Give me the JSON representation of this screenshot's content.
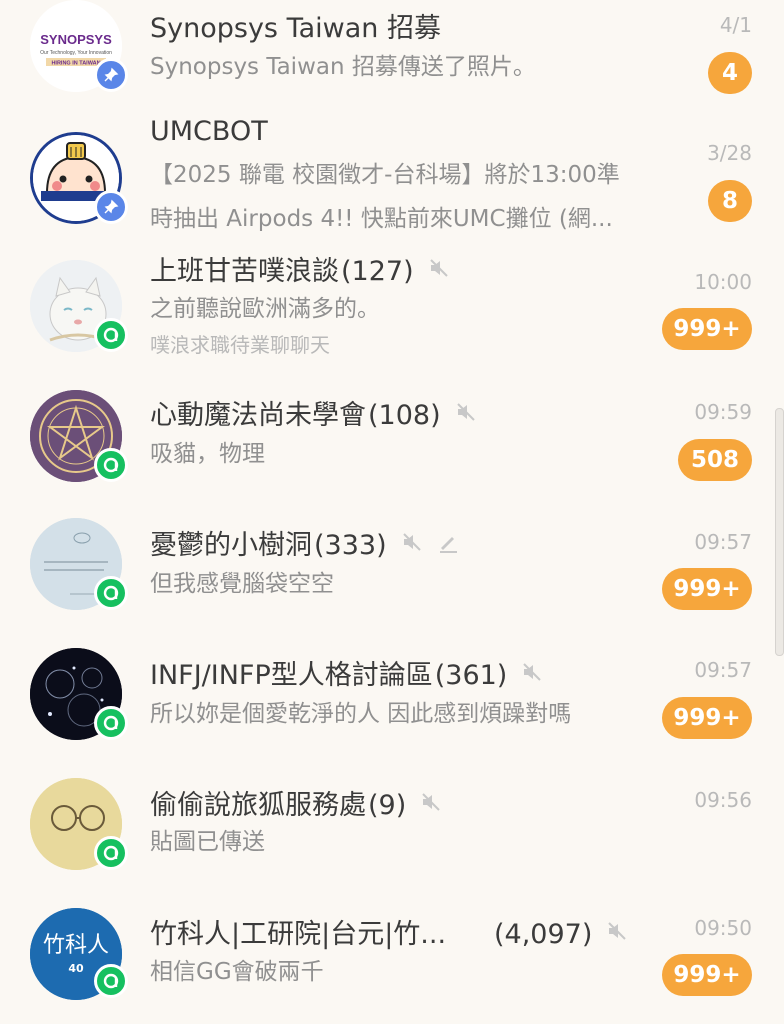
{
  "chats": [
    {
      "title": "Synopsys Taiwan 招募",
      "preview": "Synopsys Taiwan 招募傳送了照片。",
      "date": "4/1",
      "unread": "4",
      "avatar_text": {
        "brand": "SYNOPSYS",
        "tagline": "Our Technology, Your Innovation",
        "banner": "HIRING IN TAIWAN"
      },
      "badge": "pin-icon"
    },
    {
      "title": "UMCBOT",
      "preview_line1": "【2025 聯電 校園徵才-台科場】將於13:00準",
      "preview_line2": "時抽出 Airpods 4!! 快點前來UMC攤位 (網...",
      "date": "3/28",
      "unread": "8",
      "badge": "pin-icon"
    },
    {
      "title": "上班甘苦噗浪談",
      "member_count": "(127)",
      "preview": "之前聽說歐洲滿多的。",
      "subtitle": "噗浪求職待業聊聊天",
      "time": "10:00",
      "unread": "999+",
      "badge": "openchat-icon",
      "muted": true
    },
    {
      "title": "心動魔法尚未學會",
      "member_count": "(108)",
      "preview": "吸貓，物理",
      "time": "09:59",
      "unread": "508",
      "badge": "openchat-icon",
      "muted": true
    },
    {
      "title": "憂鬱的小樹洞",
      "member_count": "(333)",
      "preview": "但我感覺腦袋空空",
      "time": "09:57",
      "unread": "999+",
      "badge": "openchat-icon",
      "muted": true,
      "draft": true
    },
    {
      "title": "INFJ/INFP型人格討論區",
      "member_count": "(361)",
      "preview": "所以妳是個愛乾淨的人 因此感到煩躁對嗎",
      "time": "09:57",
      "unread": "999+",
      "badge": "openchat-icon",
      "muted": true
    },
    {
      "title": "偷偷說旅狐服務處",
      "member_count": "(9)",
      "preview": "貼圖已傳送",
      "time": "09:56",
      "badge": "openchat-icon",
      "muted": true
    },
    {
      "title": "竹科人|工研院|台元|竹...",
      "member_count": "(4,097)",
      "preview": "相信GG會破兩千",
      "time": "09:50",
      "unread": "999+",
      "badge": "openchat-icon",
      "muted": true,
      "avatar_text": {
        "main": "竹科人",
        "sub": "40"
      }
    }
  ],
  "colors": {
    "background": "#fbf8f3",
    "unread_badge": "#f6a63c",
    "pin_badge": "#5a86e8",
    "openchat_badge": "#16c060",
    "title_text": "#3b3b3b",
    "preview_text": "#909090",
    "time_text": "#b9b9b9"
  }
}
